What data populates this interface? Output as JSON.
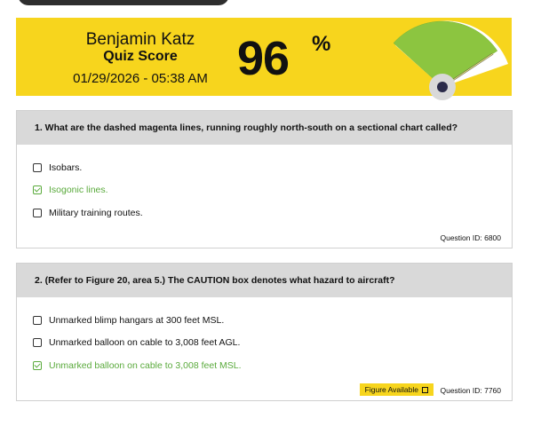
{
  "header": {
    "student_name": "Benjamin Katz",
    "label": "Quiz Score",
    "datetime": "01/29/2026 - 05:38 AM",
    "score": "96",
    "percent_sign": "%",
    "score_value": 0.96
  },
  "colors": {
    "banner": "#f7d51d",
    "correct": "#5aaa3c",
    "gauge_fill": "#8cc540",
    "question_header": "#d9d9d9"
  },
  "questions": [
    {
      "text": "1. What are the dashed magenta lines, running roughly north-south on a sectional chart called?",
      "answers": [
        {
          "text": "Isobars.",
          "correct": false
        },
        {
          "text": "Isogonic lines.",
          "correct": true
        },
        {
          "text": "Military training routes.",
          "correct": false
        }
      ],
      "question_id": "Question ID: 6800"
    },
    {
      "text": "2. (Refer to Figure 20, area 5.) The CAUTION box denotes what hazard to aircraft?",
      "answers": [
        {
          "text": "Unmarked blimp hangars at 300 feet MSL.",
          "correct": false
        },
        {
          "text": "Unmarked balloon on cable to 3,008 feet AGL.",
          "correct": false
        },
        {
          "text": "Unmarked balloon on cable to 3,008 feet MSL.",
          "correct": true
        }
      ],
      "figure_badge": "Figure Available",
      "figure_icon": "external-link-icon",
      "question_id": "Question ID: 7760"
    }
  ]
}
